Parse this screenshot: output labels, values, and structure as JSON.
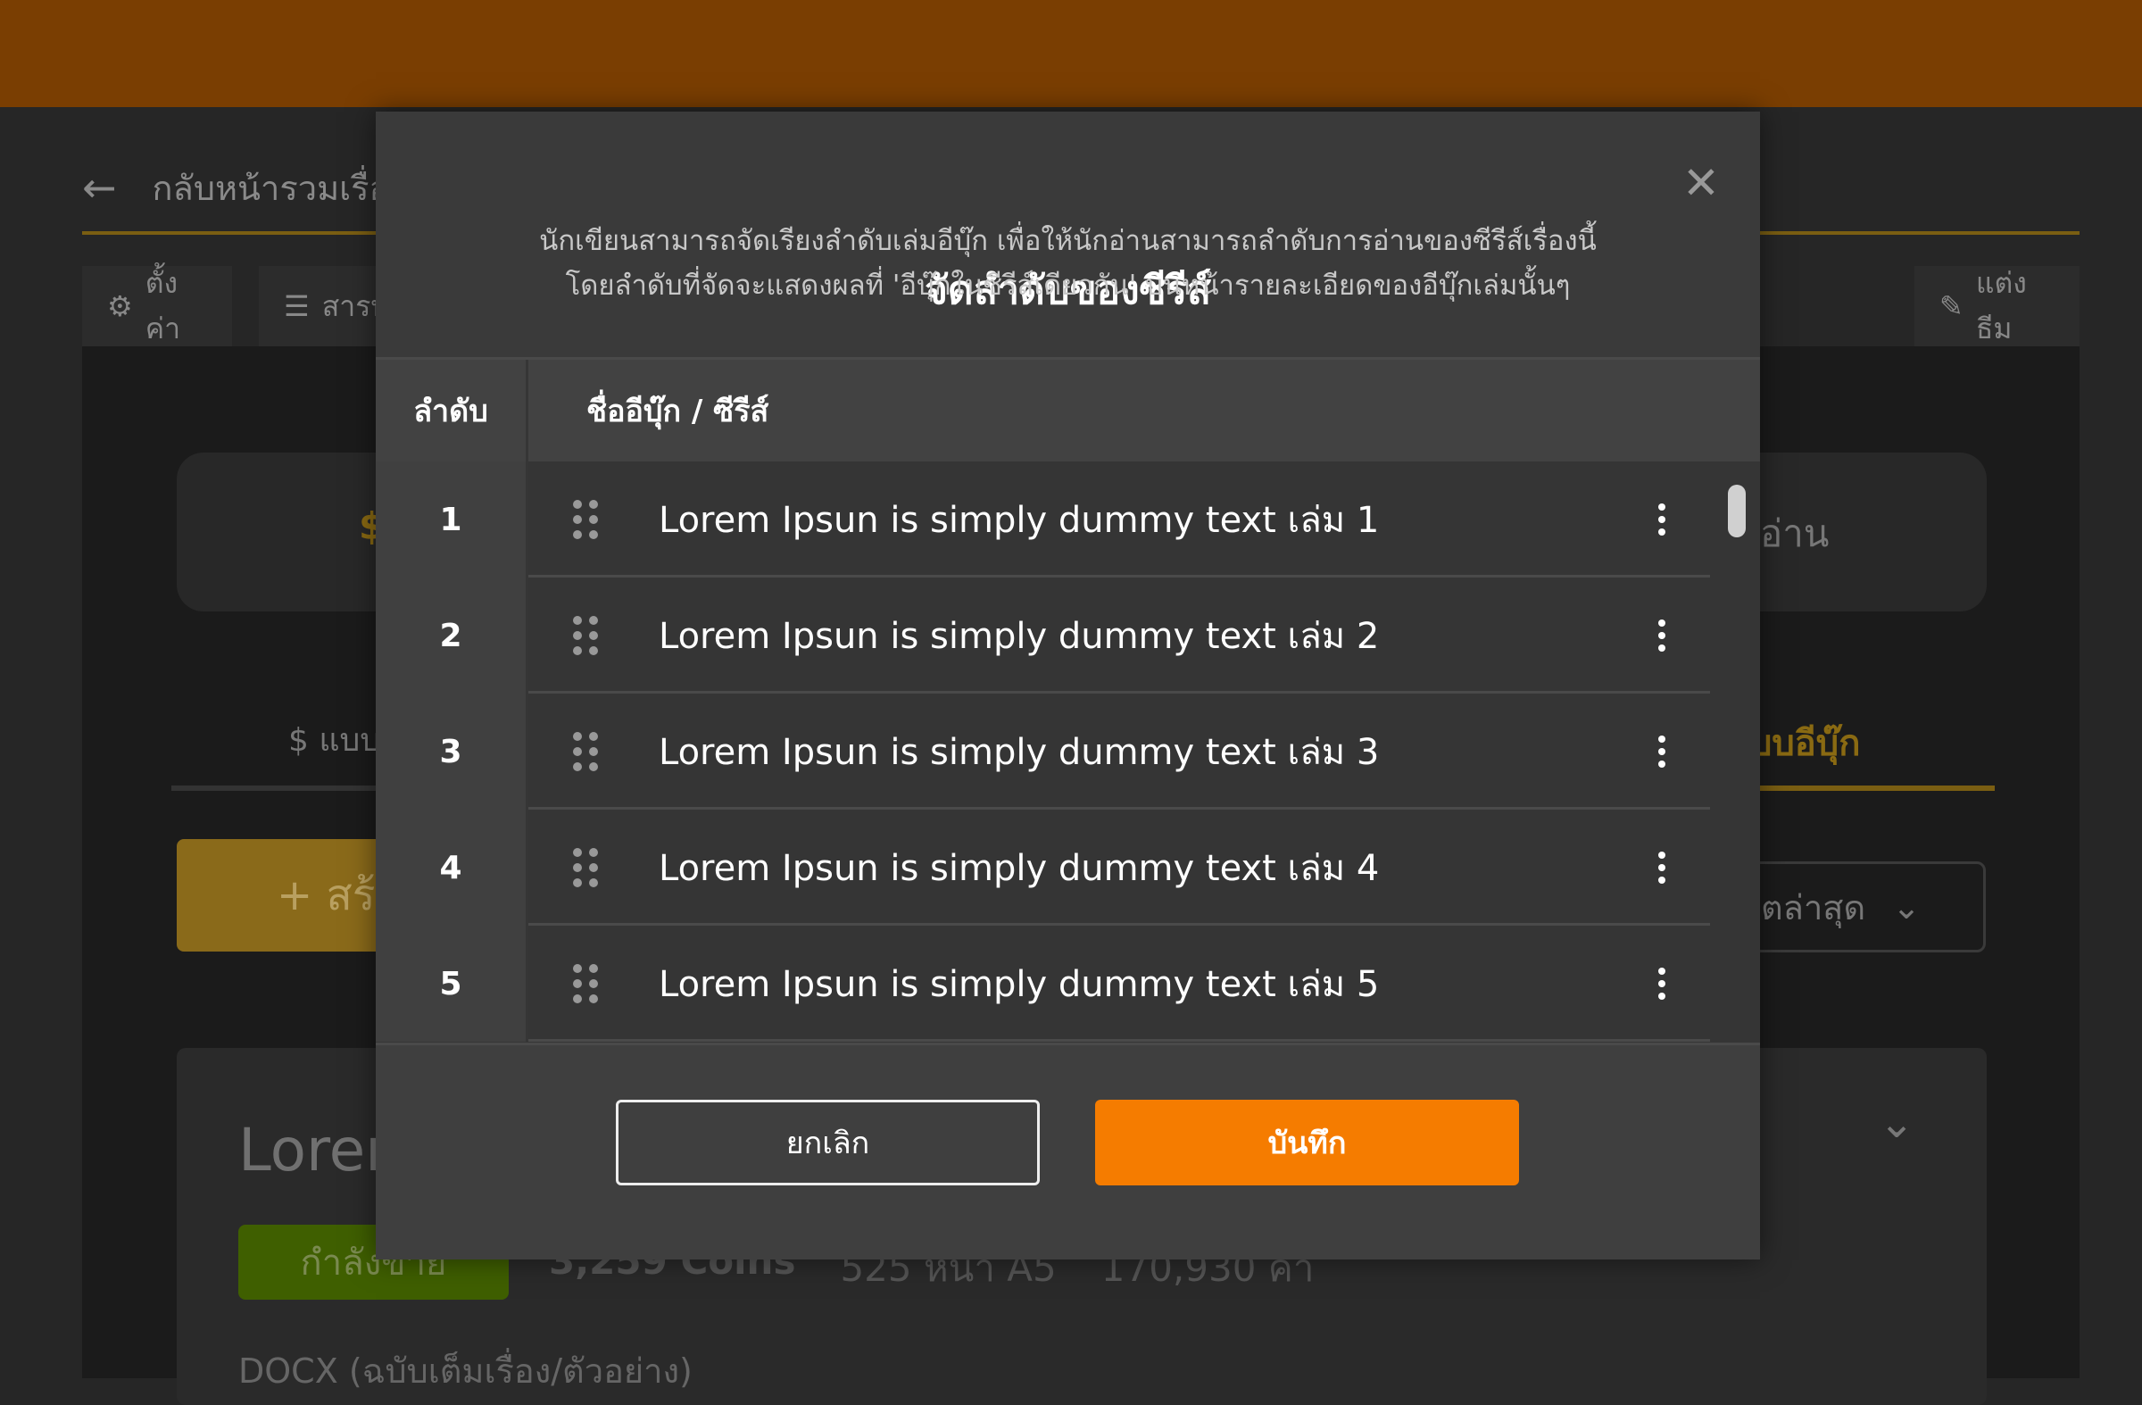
{
  "topbar_color": "#7a3e02",
  "background": {
    "back_label": "กลับหน้ารวมเรื่อ",
    "tabs": [
      {
        "label": "ตั้งค่า",
        "icon": "gear-icon"
      },
      {
        "label": "สารบ",
        "icon": "list-ordered-icon"
      },
      {
        "label": "แต่งธีม",
        "icon": "pencil-icon"
      }
    ],
    "price_fragment": "$",
    "read_fragment": "อ่าน",
    "subtab_left": "$ แบบ",
    "subtab_right": "บบอีบุ๊ก",
    "create_button": "+ สร้",
    "sort_fragment": "ดตล่าสุด",
    "book_title_fragment": "Loren",
    "status_badge": "กำลังขาย",
    "coins": "3,259 Coins",
    "pages": "525 หน้า A5",
    "words": "170,930 คำ",
    "file_format": "DOCX (ฉบับเต็มเรื่อง/ตัวอย่าง)"
  },
  "modal": {
    "title": "จัดลำดับของซีรีส์",
    "description_line1": "นักเขียนสามารถจัดเรียงลำดับเล่มอีบุ๊ก เพื่อให้นักอ่านสามารถลำดับการอ่านของซีรีส์เรื่องนี้",
    "description_line2": "โดยลำดับที่จัดจะแสดงผลที่ 'อีบุ๊กในซีรีส์เดียวกัน' บนหน้ารายละเอียดของอีบุ๊กเล่มนั้นๆ",
    "columns": [
      "ลำดับ",
      "ชื่ออีบุ๊ก / ซีรีส์"
    ],
    "rows": [
      {
        "order": "1",
        "title": "Lorem Ipsun is simply dummy text เล่ม 1"
      },
      {
        "order": "2",
        "title": "Lorem Ipsun is simply dummy text เล่ม 2"
      },
      {
        "order": "3",
        "title": "Lorem Ipsun is simply dummy text เล่ม 3"
      },
      {
        "order": "4",
        "title": "Lorem Ipsun is simply dummy text เล่ม 4"
      },
      {
        "order": "5",
        "title": "Lorem Ipsun is simply dummy text เล่ม 5"
      }
    ],
    "cancel_label": "ยกเลิก",
    "save_label": "บันทึก",
    "save_color": "#f57c00"
  }
}
